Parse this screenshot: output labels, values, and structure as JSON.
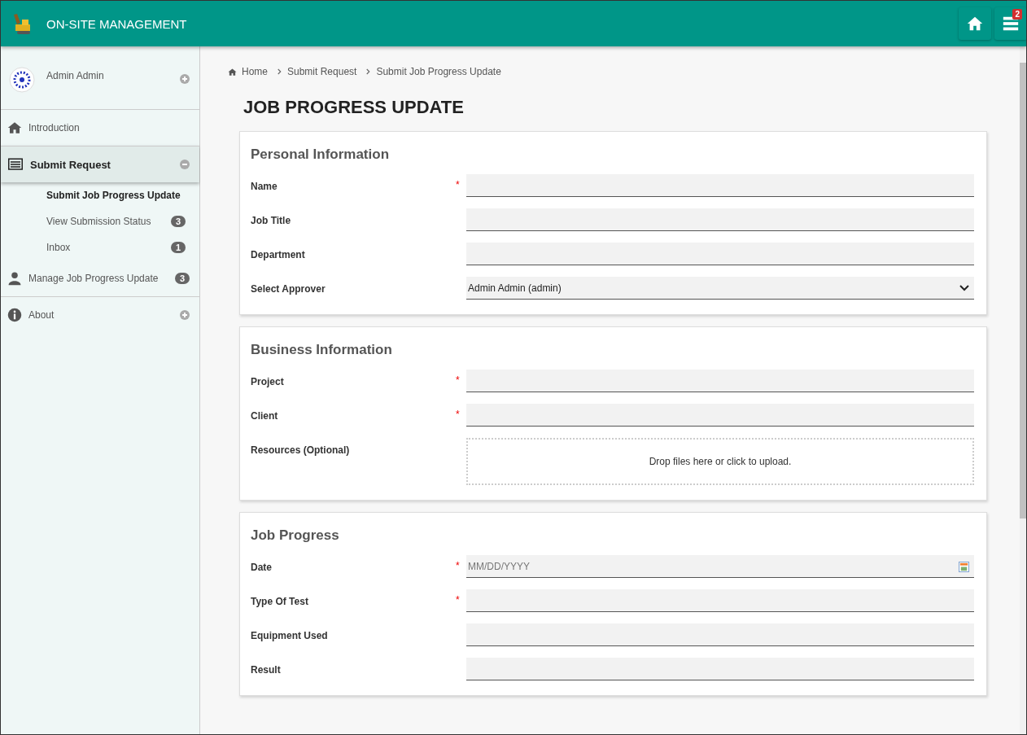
{
  "header": {
    "title": "ON-SITE MANAGEMENT",
    "notification_count": "2"
  },
  "user": {
    "name": "Admin Admin",
    "expanded": false
  },
  "sidebar": {
    "items": [
      {
        "kind": "home",
        "label": "Introduction",
        "selected": false
      },
      {
        "kind": "list",
        "label": "Submit Request",
        "selected": true,
        "expanded": true,
        "children": [
          {
            "label": "Submit Job Progress Update",
            "selected": true
          },
          {
            "label": "View Submission Status",
            "selected": false,
            "badge": "3"
          },
          {
            "label": "Inbox",
            "selected": false,
            "badge": "1"
          }
        ]
      },
      {
        "kind": "user",
        "label": "Manage Job Progress Update",
        "selected": false,
        "badge": "3"
      },
      {
        "kind": "info",
        "label": "About",
        "selected": false,
        "expanded": false
      }
    ]
  },
  "breadcrumb": [
    "Home",
    "Submit Request",
    "Submit Job Progress Update"
  ],
  "page_title": "JOB PROGRESS UPDATE",
  "sections": [
    {
      "title": "Personal Information",
      "fields": [
        {
          "kind": "text",
          "label": "Name",
          "required_mark": "*"
        },
        {
          "kind": "text",
          "label": "Job Title"
        },
        {
          "kind": "text",
          "label": "Department"
        },
        {
          "kind": "select",
          "label": "Select Approver",
          "value": "Admin Admin (admin)"
        }
      ]
    },
    {
      "title": "Business Information",
      "fields": [
        {
          "kind": "text",
          "label": "Project",
          "required_mark": "*"
        },
        {
          "kind": "text",
          "label": "Client",
          "required_mark": "*"
        },
        {
          "kind": "upload",
          "label": "Resources (Optional)",
          "value": "Drop files here or click to upload."
        }
      ]
    },
    {
      "title": "Job Progress",
      "fields": [
        {
          "kind": "date",
          "label": "Date",
          "required_mark": "*",
          "placeholder": "MM/DD/YYYY"
        },
        {
          "kind": "text",
          "label": "Type Of Test",
          "required_mark": "*"
        },
        {
          "kind": "text",
          "label": "Equipment Used"
        },
        {
          "kind": "text",
          "label": "Result"
        }
      ]
    }
  ]
}
